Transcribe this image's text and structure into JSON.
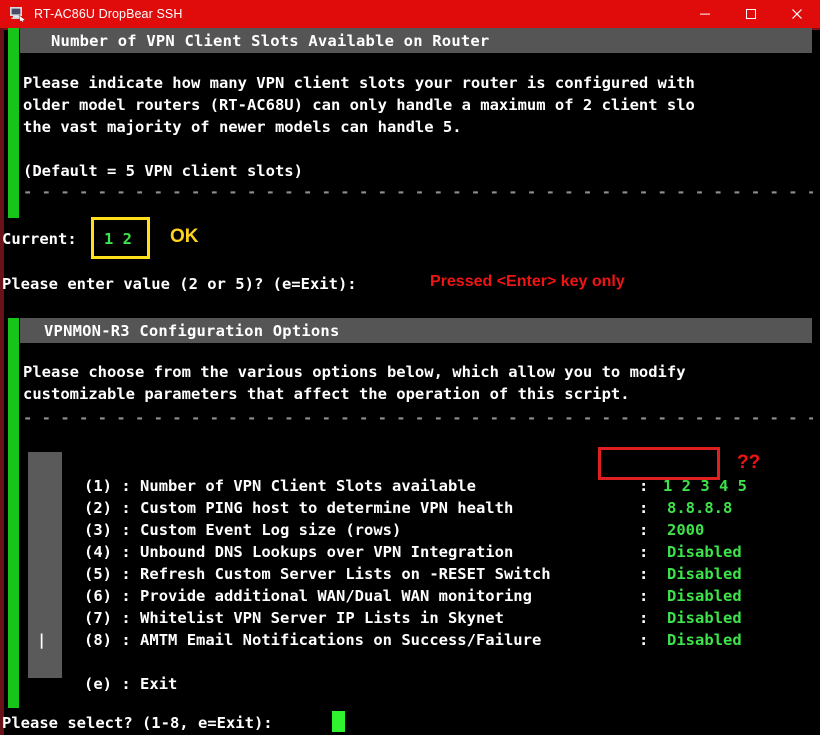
{
  "window": {
    "title": "RT-AC86U DropBear SSH",
    "icon": "ssh-terminal-icon",
    "titlebar_color": "#e00b0b",
    "controls": {
      "minimize": "minimize-icon",
      "maximize": "maximize-icon",
      "close": "close-icon"
    }
  },
  "section_one": {
    "header": "Number of VPN Client Slots Available on Router",
    "body_lines": [
      "Please indicate how many VPN client slots your router is configured with",
      "older model routers (RT-AC68U) can only handle a maximum of 2 client slo",
      "the vast majority of newer models can handle 5."
    ],
    "default_note": "(Default = 5 VPN client slots)",
    "current_label": "Current:",
    "current_value": "1 2",
    "ok_label": "OK",
    "prompt": "Please enter value (2 or 5)? (e=Exit):",
    "prompt_annotation": "Pressed <Enter> key only"
  },
  "section_two": {
    "header": "VPNMON-R3 Configuration Options",
    "intro_lines": [
      "Please choose from the various options below, which allow you to modify",
      "customizable parameters that affect the operation of this script."
    ],
    "menu": [
      {
        "key": "(1)",
        "sep": ":",
        "label": "Number of VPN Client Slots available",
        "value_sep": ":",
        "value": "1 2 3 4 5"
      },
      {
        "key": "(2)",
        "sep": ":",
        "label": "Custom PING host to determine VPN health",
        "value_sep": ":",
        "value": "8.8.8.8"
      },
      {
        "key": "(3)",
        "sep": ":",
        "label": "Custom Event Log size (rows)",
        "value_sep": ":",
        "value": "2000"
      },
      {
        "key": "(4)",
        "sep": ":",
        "label": "Unbound DNS Lookups over VPN Integration",
        "value_sep": ":",
        "value": "Disabled"
      },
      {
        "key": "(5)",
        "sep": ":",
        "label": "Refresh Custom Server Lists on -RESET Switch",
        "value_sep": ":",
        "value": "Disabled"
      },
      {
        "key": "(6)",
        "sep": ":",
        "label": "Provide additional WAN/Dual WAN monitoring",
        "value_sep": ":",
        "value": "Disabled"
      },
      {
        "key": "(7)",
        "sep": ":",
        "label": "Whitelist VPN Server IP Lists in Skynet",
        "value_sep": ":",
        "value": "Disabled"
      },
      {
        "key": "(8)",
        "sep": ":",
        "label": "AMTM Email Notifications on Success/Failure",
        "value_sep": ":",
        "value": "Disabled"
      }
    ],
    "divider_key": "|",
    "exit_key": "(e)",
    "exit_sep": ":",
    "exit_label": "Exit",
    "menu_annotation": "??",
    "select_prompt": "Please select? (1-8, e=Exit):"
  },
  "separators": {
    "dashes_top": "- - - - - - - - - - - - - - - - - - - - - - - - - - - - - - - - - - - - - - - - - - - - - - - - - - - - - - - - - -",
    "dashes_mid": "- - - - - - - - - - - - - - - - - - - - - - - - - - - - - - - - - - - - - - - - - - - - - - - - - - - - - - - - - -"
  },
  "colors": {
    "terminal_bg": "#000000",
    "text": "#ffffff",
    "green_value": "#3de34a",
    "accent_bar": "#17c419",
    "header_bar": "#555555",
    "annotation_red": "#f01414",
    "annotation_gold": "#ffd21e",
    "highlight_box_yellow": "#ffe01a",
    "highlight_box_red": "#e02020"
  }
}
